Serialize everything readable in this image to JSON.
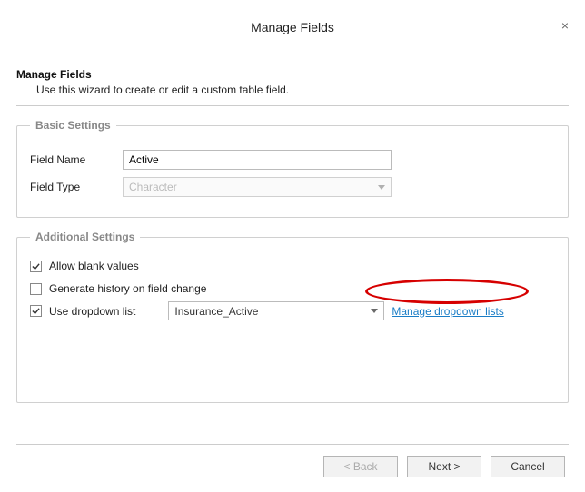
{
  "dialog": {
    "title": "Manage Fields",
    "close_label": "×"
  },
  "intro": {
    "heading": "Manage Fields",
    "subtext": "Use this wizard to create or edit a custom table field."
  },
  "basic": {
    "legend": "Basic Settings",
    "field_name_label": "Field Name",
    "field_name_value": "Active",
    "field_type_label": "Field Type",
    "field_type_value": "Character"
  },
  "additional": {
    "legend": "Additional Settings",
    "allow_blank_label": "Allow blank values",
    "allow_blank_checked": true,
    "gen_history_label": "Generate history on field change",
    "gen_history_checked": false,
    "use_dropdown_label": "Use dropdown list",
    "use_dropdown_checked": true,
    "dropdown_value": "Insurance_Active",
    "manage_link": "Manage dropdown lists"
  },
  "buttons": {
    "back": "< Back",
    "next": "Next >",
    "cancel": "Cancel"
  }
}
